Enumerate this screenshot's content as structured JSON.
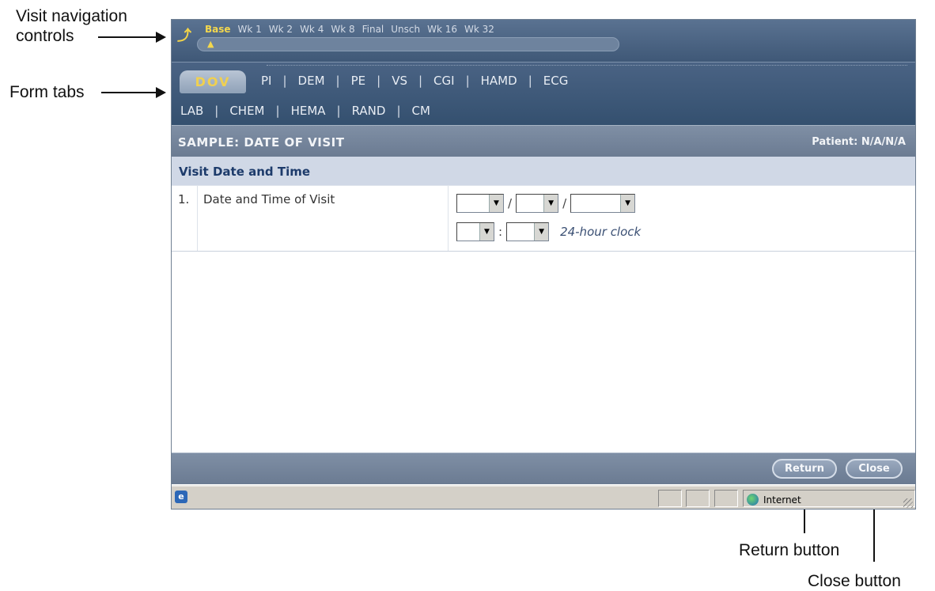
{
  "callouts": {
    "visit_nav": "Visit navigation controls",
    "visit_nav_line1": "Visit navigation",
    "visit_nav_line2": "controls",
    "form_tabs": "Form tabs",
    "return_button": "Return button",
    "close_button": "Close button"
  },
  "visits": {
    "back_icon": "up-arrow-icon",
    "items": [
      "Base",
      "Wk 1",
      "Wk 2",
      "Wk 4",
      "Wk 8",
      "Final",
      "Unsch",
      "Wk 16",
      "Wk 32"
    ],
    "active": "Base"
  },
  "tabs": {
    "active": "DOV",
    "row1": [
      "PI",
      "DEM",
      "PE",
      "VS",
      "CGI",
      "HAMD",
      "ECG"
    ],
    "row2": [
      "LAB",
      "CHEM",
      "HEMA",
      "RAND",
      "CM"
    ],
    "separator": "|"
  },
  "form": {
    "title": "SAMPLE: DATE OF VISIT",
    "patient": "Patient: N/A/N/A",
    "section": "Visit Date and Time",
    "question_number": "1.",
    "question_label": "Date and Time of Visit",
    "date_separator": "/",
    "time_separator": ":",
    "clock_note": "24-hour clock"
  },
  "buttons": {
    "return": "Return",
    "close": "Close"
  },
  "statusbar": {
    "zone": "Internet"
  },
  "colors": {
    "header_blue": "#3f5877",
    "active_visit": "#f3d74d",
    "section_bg": "#d0d8e6"
  }
}
